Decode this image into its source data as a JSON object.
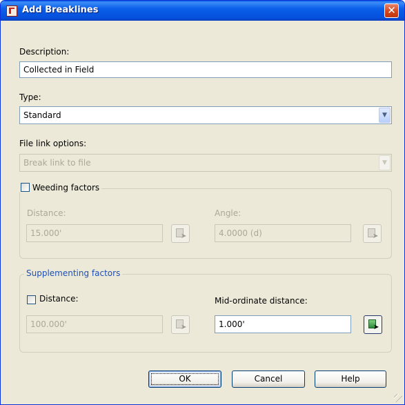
{
  "window": {
    "title": "Add Breaklines",
    "close_glyph": "✕",
    "icon": "app-icon",
    "accent": "#0a5fe9"
  },
  "description": {
    "label": "Description:",
    "value": "Collected in Field"
  },
  "type": {
    "label": "Type:",
    "selected": "Standard"
  },
  "file_link": {
    "label": "File link options:",
    "selected": "Break link to file",
    "disabled": true
  },
  "weeding": {
    "checkbox_label": "Weeding factors",
    "checked": false,
    "distance": {
      "label": "Distance:",
      "value": "15.000'",
      "disabled": true
    },
    "angle": {
      "label": "Angle:",
      "value": "4.0000 (d)",
      "disabled": true
    }
  },
  "supplementing": {
    "title": "Supplementing factors",
    "distance_checkbox_label": "Distance:",
    "distance_checked": false,
    "distance_value": "100.000'",
    "mid_ordinate": {
      "label": "Mid-ordinate distance:",
      "value": "1.000'"
    }
  },
  "buttons": {
    "ok": "OK",
    "cancel": "Cancel",
    "help": "Help"
  }
}
